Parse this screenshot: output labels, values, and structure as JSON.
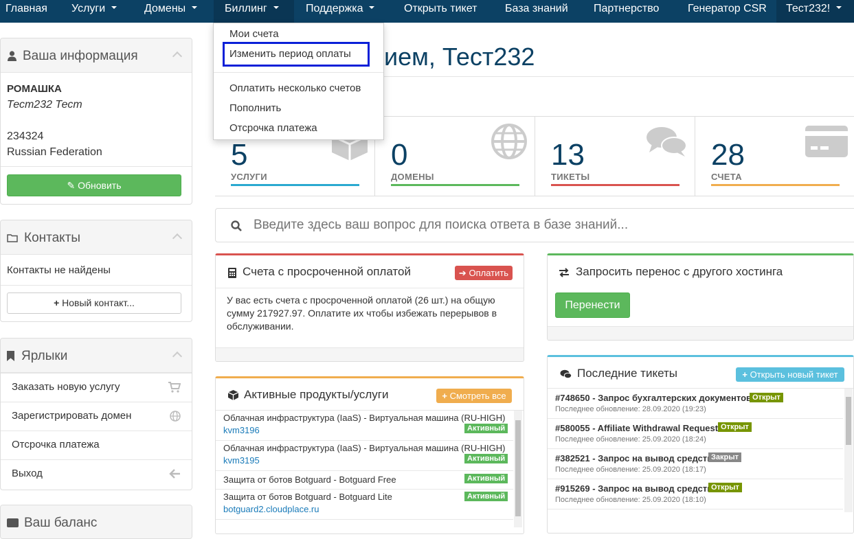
{
  "nav": {
    "home": "Главная",
    "services": "Услуги",
    "domains": "Домены",
    "billing": "Биллинг",
    "support": "Поддержка",
    "open_ticket": "Открыть тикет",
    "kb": "База знаний",
    "partners": "Партнерство",
    "csr": "Генератор CSR",
    "user": "Тест232!"
  },
  "billing_menu": {
    "item1": "Мои счета",
    "item2": "Изменить период оплаты",
    "item3": "Оплатить несколько счетов",
    "item4": "Пополнить",
    "item5": "Отсрочка платежа"
  },
  "welcome": {
    "title": "ием, Тест232"
  },
  "your_info": {
    "title": "Ваша информация",
    "company": "РОМАШКА",
    "name": "Тест232 Тест",
    "postcode": "234324",
    "country": "Russian Federation",
    "update_btn": "Обновить"
  },
  "contacts": {
    "title": "Контакты",
    "empty": "Контакты не найдены",
    "new_btn": "Новый контакт..."
  },
  "shortcuts": {
    "title": "Ярлыки",
    "items": [
      "Заказать новую услугу",
      "Зарегистрировать домен",
      "Отсрочка платежа",
      "Выход"
    ]
  },
  "balance": {
    "title": "Ваш баланс"
  },
  "stats": [
    {
      "num": "5",
      "label": "УСЛУГИ",
      "color": "#2aa9d0"
    },
    {
      "num": "0",
      "label": "ДОМЕНЫ",
      "color": "#5cb85c"
    },
    {
      "num": "13",
      "label": "ТИКЕТЫ",
      "color": "#d9534f"
    },
    {
      "num": "28",
      "label": "СЧЕТА",
      "color": "#f0ad4e"
    }
  ],
  "search": {
    "placeholder": "Введите здесь ваш вопрос для поиска ответа в базе знаний..."
  },
  "overdue": {
    "title": "Счета с просроченной оплатой",
    "pay_btn": "Оплатить",
    "text": "У вас есть счета с просроченной оплатой (26 шт.) на общую сумму 217927.97. Оплатите их чтобы избежать перерывов в обслуживании."
  },
  "transfer": {
    "title": "Запросить перенос с другого хостинга",
    "btn": "Перенести"
  },
  "products": {
    "title": "Активные продукты/услуги",
    "btn": "Смотреть все",
    "items": [
      {
        "name": "Облачная инфраструктура (IaaS) - Виртуальная машина (RU-HIGH)",
        "link": "kvm3196",
        "status": "Активный"
      },
      {
        "name": "Облачная инфраструктура (IaaS) - Виртуальная машина (RU-HIGH)",
        "link": "kvm3195",
        "status": "Активный"
      },
      {
        "name": "Защита от ботов Botguard - Botguard Free",
        "link": "",
        "status": "Активный"
      },
      {
        "name": "Защита от ботов Botguard - Botguard Lite",
        "link": "botguard2.cloudplace.ru",
        "status": "Активный"
      }
    ]
  },
  "tickets": {
    "title": "Последние тикеты",
    "btn": "Открыть новый тикет",
    "items": [
      {
        "title": "#748650 - Запрос бухгалтерских документов",
        "date": "Последнее обновление: 28.09.2020 (19:23)",
        "status": "Открыт",
        "color": "#779500"
      },
      {
        "title": "#580055 - Affiliate Withdrawal Request",
        "date": "Последнее обновление: 25.09.2020 (18:24)",
        "status": "Открыт",
        "color": "#779500"
      },
      {
        "title": "#382521 - Запрос на вывод средств",
        "date": "Последнее обновление: 25.09.2020 (18:17)",
        "status": "Закрыт",
        "color": "#888888"
      },
      {
        "title": "#915269 - Запрос на вывод средств",
        "date": "Последнее обновление: 25.09.2020 (18:10)",
        "status": "Открыт",
        "color": "#779500"
      }
    ]
  }
}
